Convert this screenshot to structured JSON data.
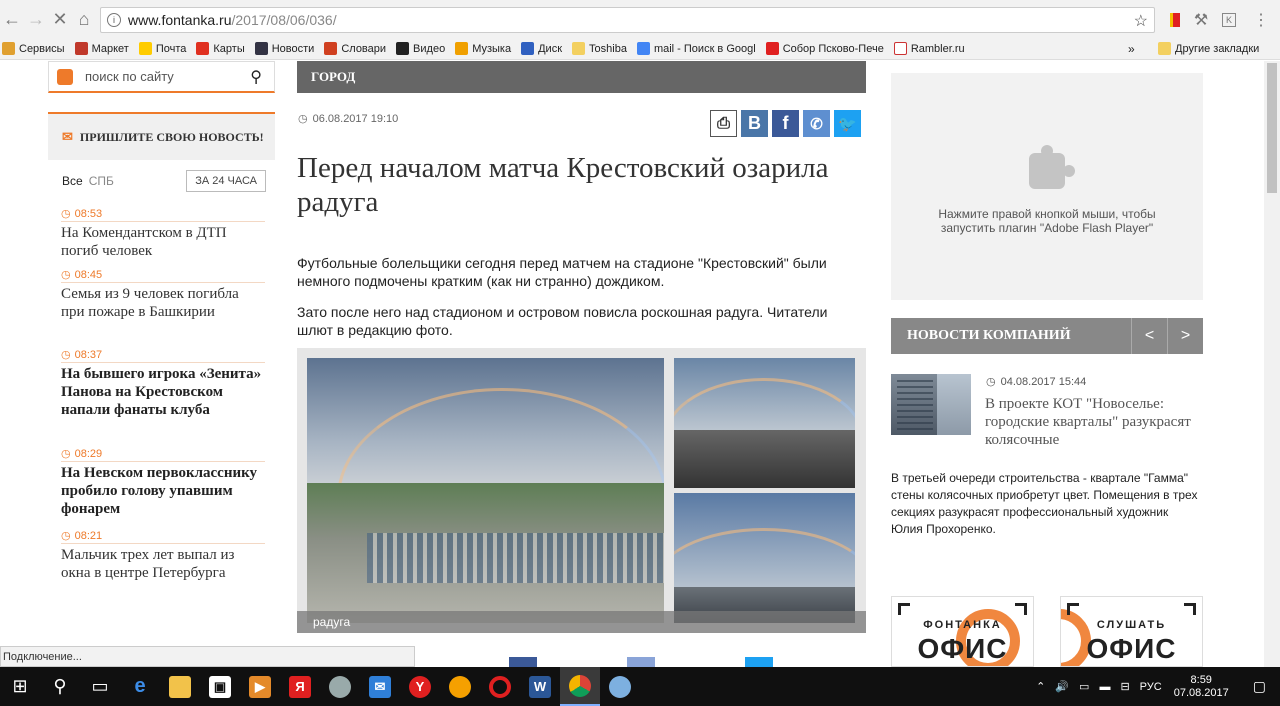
{
  "browser": {
    "url_host": "www.fontanka.ru",
    "url_path": "/2017/08/06/036/"
  },
  "bookmarks": [
    {
      "label": "Сервисы",
      "color": "#e0a030"
    },
    {
      "label": "Маркет",
      "color": "#c0392b"
    },
    {
      "label": "Почта",
      "color": "#ffcc00"
    },
    {
      "label": "Карты",
      "color": "#e03020"
    },
    {
      "label": "Новости",
      "color": "#334"
    },
    {
      "label": "Словари",
      "color": "#d04020"
    },
    {
      "label": "Видео",
      "color": "#222"
    },
    {
      "label": "Музыка",
      "color": "#f0a000"
    },
    {
      "label": "Диск",
      "color": "#3060c0"
    },
    {
      "label": "Toshiba",
      "color": "#f3d060"
    },
    {
      "label": "mail - Поиск в Googl",
      "color": "#4285f4"
    },
    {
      "label": "Собор Псково-Пече",
      "color": "#e02020"
    },
    {
      "label": "Rambler.ru",
      "color": "#fff"
    }
  ],
  "bookmarks_more": "»",
  "bookmarks_other": "Другие закладки",
  "search": {
    "placeholder": "поиск по сайту"
  },
  "send_news": "ПРИШЛИТЕ СВОЮ НОВОСТЬ!",
  "filters": {
    "all": "Все",
    "spb": "СПБ",
    "day": "ЗА 24 ЧАСА"
  },
  "news": [
    {
      "time": "08:53",
      "title": "На Комендантском в ДТП погиб человек",
      "bold": false
    },
    {
      "time": "08:45",
      "title": "Семья из 9 человек погибла при пожаре в Башкирии",
      "bold": false
    },
    {
      "time": "08:37",
      "title": "На бывшего игрока «Зенита» Панова на Крестовском напали фанаты клуба",
      "bold": true
    },
    {
      "time": "08:29",
      "title": "На Невском первокласснику пробило голову упавшим фонарем",
      "bold": true
    },
    {
      "time": "08:21",
      "title": "Мальчик трех лет выпал из окна в центре Петербурга",
      "bold": false
    }
  ],
  "article": {
    "section": "ГОРОД",
    "date": "06.08.2017 19:10",
    "headline": "Перед началом матча Крестовский озарила радуга",
    "p1": "Футбольные болельщики сегодня перед матчем на стадионе \"Крестовский\" были немного подмочены кратким (как ни странно) дождиком.",
    "p2": "Зато после него над стадионом и островом повисла роскошная радуга. Читатели шлют в редакцию фото.",
    "caption": "радуга"
  },
  "share": {
    "vk": "В",
    "fb": "f"
  },
  "flash": {
    "message": "Нажмите правой кнопкой мыши, чтобы запустить плагин \"Adobe Flash Player\""
  },
  "company_news": {
    "label": "НОВОСТИ КОМПАНИЙ",
    "prev": "<",
    "next": ">",
    "date": "04.08.2017 15:44",
    "title": "В проекте КОТ \"Новоселье: городские кварталы\" разукрасят колясочные",
    "desc": "В третьей очереди строительства - квартале \"Гамма\" стены колясочных приобретут цвет. Помещения в трех секциях разукрасят профессиональный художник Юлия Прохоренко."
  },
  "promos": [
    {
      "small": "ФОНТАНКА",
      "big": "ОФИС"
    },
    {
      "small": "СЛУШАТЬ",
      "big": "ОФИС"
    }
  ],
  "status_text": "Подключение...",
  "tray": {
    "lang": "РУС",
    "time": "8:59",
    "date": "07.08.2017"
  },
  "colors": {
    "accent": "#ee7a2a",
    "section_bar": "#666666",
    "vk": "#4a76a8",
    "fb": "#3b5998",
    "viber": "#5e8fd0",
    "twitter": "#1da1f2"
  }
}
